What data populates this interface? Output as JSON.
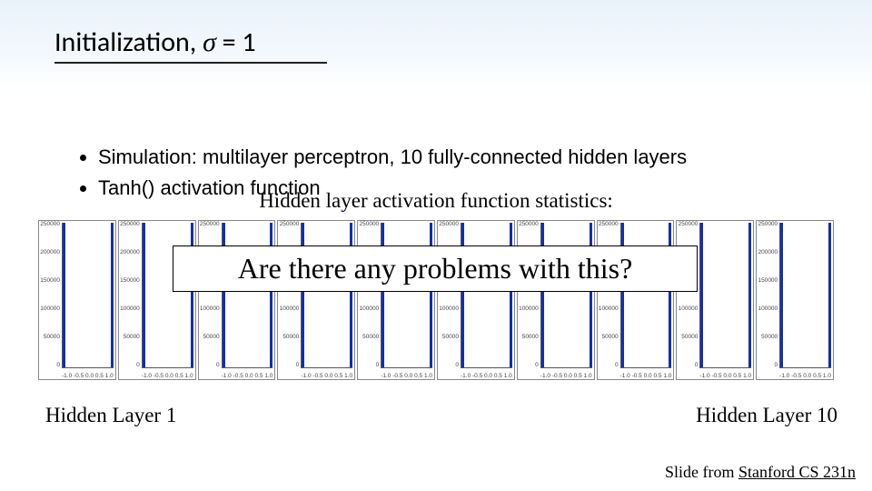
{
  "title": {
    "main": "Initialization,",
    "sigma": "σ",
    "rest": " = 1"
  },
  "bullets": [
    "Simulation: multilayer perceptron, 10 fully-connected hidden layers",
    "Tanh() activation function"
  ],
  "stats_heading": "Hidden layer activation function statistics:",
  "overlay_question": "Are there any problems with this?",
  "layer_labels": {
    "left": "Hidden Layer 1",
    "right": "Hidden Layer 10"
  },
  "attribution": {
    "prefix": "Slide from ",
    "link_text": "Stanford CS 231n"
  },
  "chart_data": [
    {
      "type": "bar",
      "title": "",
      "xlabel": "",
      "ylabel": "",
      "categories": [
        "-1.0",
        "-0.5",
        "0.0",
        "0.5",
        "1.0"
      ],
      "values": [
        250000,
        0,
        0,
        0,
        250000
      ],
      "ylim": [
        0,
        250000
      ],
      "yticks": [
        0,
        50000,
        100000,
        150000,
        200000,
        250000
      ],
      "xlim": [
        -1.0,
        1.0
      ]
    },
    {
      "type": "bar",
      "categories": [
        "-1.0",
        "-0.5",
        "0.0",
        "0.5",
        "1.0"
      ],
      "values": [
        250000,
        0,
        0,
        0,
        250000
      ],
      "ylim": [
        0,
        250000
      ],
      "yticks": [
        0,
        50000,
        100000,
        150000,
        200000,
        250000
      ],
      "xlim": [
        -1.0,
        1.0
      ]
    },
    {
      "type": "bar",
      "categories": [
        "-1.0",
        "-0.5",
        "0.0",
        "0.5",
        "1.0"
      ],
      "values": [
        250000,
        0,
        0,
        0,
        250000
      ],
      "ylim": [
        0,
        250000
      ],
      "yticks": [
        0,
        50000,
        100000,
        150000,
        200000,
        250000
      ],
      "xlim": [
        -1.0,
        1.0
      ]
    },
    {
      "type": "bar",
      "categories": [
        "-1.0",
        "-0.5",
        "0.0",
        "0.5",
        "1.0"
      ],
      "values": [
        250000,
        0,
        0,
        0,
        250000
      ],
      "ylim": [
        0,
        250000
      ],
      "yticks": [
        0,
        50000,
        100000,
        150000,
        200000,
        250000
      ],
      "xlim": [
        -1.0,
        1.0
      ]
    },
    {
      "type": "bar",
      "categories": [
        "-1.0",
        "-0.5",
        "0.0",
        "0.5",
        "1.0"
      ],
      "values": [
        250000,
        0,
        0,
        0,
        250000
      ],
      "ylim": [
        0,
        250000
      ],
      "yticks": [
        0,
        50000,
        100000,
        150000,
        200000,
        250000
      ],
      "xlim": [
        -1.0,
        1.0
      ]
    },
    {
      "type": "bar",
      "categories": [
        "-1.0",
        "-0.5",
        "0.0",
        "0.5",
        "1.0"
      ],
      "values": [
        250000,
        0,
        0,
        0,
        250000
      ],
      "ylim": [
        0,
        250000
      ],
      "yticks": [
        0,
        50000,
        100000,
        150000,
        200000,
        250000
      ],
      "xlim": [
        -1.0,
        1.0
      ]
    },
    {
      "type": "bar",
      "categories": [
        "-1.0",
        "-0.5",
        "0.0",
        "0.5",
        "1.0"
      ],
      "values": [
        250000,
        0,
        0,
        0,
        250000
      ],
      "ylim": [
        0,
        250000
      ],
      "yticks": [
        0,
        50000,
        100000,
        150000,
        200000,
        250000
      ],
      "xlim": [
        -1.0,
        1.0
      ]
    },
    {
      "type": "bar",
      "categories": [
        "-1.0",
        "-0.5",
        "0.0",
        "0.5",
        "1.0"
      ],
      "values": [
        250000,
        0,
        0,
        0,
        250000
      ],
      "ylim": [
        0,
        250000
      ],
      "yticks": [
        0,
        50000,
        100000,
        150000,
        200000,
        250000
      ],
      "xlim": [
        -1.0,
        1.0
      ]
    },
    {
      "type": "bar",
      "categories": [
        "-1.0",
        "-0.5",
        "0.0",
        "0.5",
        "1.0"
      ],
      "values": [
        250000,
        0,
        0,
        0,
        250000
      ],
      "ylim": [
        0,
        250000
      ],
      "yticks": [
        0,
        50000,
        100000,
        150000,
        200000,
        250000
      ],
      "xlim": [
        -1.0,
        1.0
      ]
    },
    {
      "type": "bar",
      "categories": [
        "-1.0",
        "-0.5",
        "0.0",
        "0.5",
        "1.0"
      ],
      "values": [
        250000,
        0,
        0,
        0,
        250000
      ],
      "ylim": [
        0,
        250000
      ],
      "yticks": [
        0,
        50000,
        100000,
        150000,
        200000,
        250000
      ],
      "xlim": [
        -1.0,
        1.0
      ]
    }
  ]
}
